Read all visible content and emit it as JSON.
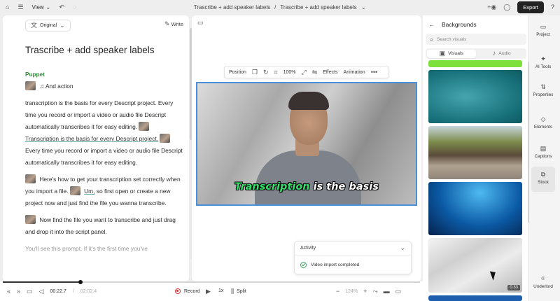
{
  "topbar": {
    "view_label": "View",
    "breadcrumb_project": "Trascribe + add speaker labels",
    "breadcrumb_separator": "/",
    "breadcrumb_composition": "Trascribe + add speaker labels",
    "export_label": "Export"
  },
  "script": {
    "mode_label": "Original",
    "write_label": "Write",
    "title": "Trascribe + add speaker labels",
    "speaker": "Puppet",
    "action_text": "And action",
    "p1_a": "transcription is the basis for every Descript project. Every time you record or import a video or audio file Descript automatically transcribes it for easy editing.",
    "p1_b": "Transcription is the basis for every Descript project.",
    "p1_c": "Every time you record or import a video or audio file Descript automatically transcribes it for easy editing.",
    "p2_a": "Here's how to get your transcription set correctly when you import a file.",
    "p2_b": "Um,",
    "p2_c": "so first open or create a new project now and just find the file you wanna transcribe.",
    "p3": "Now find the file you want to transcribe and just drag and drop it into the script panel.",
    "p4": "You'll see this prompt. If it's the first time you've"
  },
  "canvas": {
    "toolbar": {
      "position": "Position",
      "zoom": "100%",
      "effects": "Effects",
      "animation": "Animation"
    },
    "caption_highlight": "Transcription",
    "caption_rest": " is the basis",
    "activity": {
      "title": "Activity",
      "item": "Video import completed"
    }
  },
  "backgrounds": {
    "title": "Backgrounds",
    "search_placeholder": "Search visuals",
    "tab_visuals": "Visuals",
    "tab_audio": "Audio",
    "duration": "0:33"
  },
  "rail": {
    "project": "Project",
    "ai_tools": "AI Tools",
    "properties": "Properties",
    "elements": "Elements",
    "captions": "Captions",
    "stock": "Stock",
    "underlord": "Underlord"
  },
  "transport": {
    "current_time": "00:22.7",
    "separator": "/",
    "total_time": "02:02.4",
    "record_label": "Record",
    "speed": "1x",
    "split_label": "Split",
    "zoom": "124%",
    "progress": 0.186
  },
  "colors": {
    "accent_green": "#2f8a3a",
    "caption_green": "#35e06a",
    "selection_blue": "#4a90d9"
  }
}
